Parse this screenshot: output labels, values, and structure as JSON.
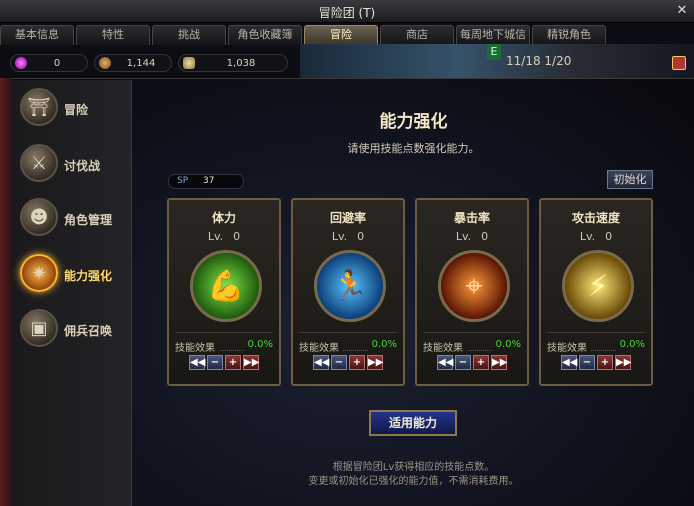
{
  "window": {
    "title": "冒险团 (T)"
  },
  "tabs": [
    {
      "label": "基本信息"
    },
    {
      "label": "特性"
    },
    {
      "label": "挑战"
    },
    {
      "label": "角色收藏簿"
    },
    {
      "label": "冒险"
    },
    {
      "label": "商店"
    },
    {
      "label": "每周地下城信息"
    },
    {
      "label": "精锐角色"
    }
  ],
  "active_tab": "冒险",
  "currency": [
    {
      "icon": "gem-icon",
      "value": "0"
    },
    {
      "icon": "coin-icon",
      "value": "1,144"
    },
    {
      "icon": "token-icon",
      "value": "1,038"
    }
  ],
  "background": {
    "date_text": "11/18 1/20",
    "e_badge": "E"
  },
  "sidebar": {
    "items": [
      {
        "label": "冒险",
        "icon": "adventure-icon",
        "glyph": "⛩"
      },
      {
        "label": "讨伐战",
        "icon": "crossed-swords-icon",
        "glyph": "⚔"
      },
      {
        "label": "角色管理",
        "icon": "character-icon",
        "glyph": "☻"
      },
      {
        "label": "能力强化",
        "icon": "star-burst-icon",
        "glyph": "✷"
      },
      {
        "label": "佣兵召唤",
        "icon": "chest-icon",
        "glyph": "▣"
      }
    ],
    "active": "能力强化"
  },
  "content": {
    "title": "能力强化",
    "subtitle": "请使用技能点数强化能力。",
    "sp_label": "SP",
    "sp_value": "37",
    "reset_label": "初始化",
    "cards": [
      {
        "name": "体力",
        "lv_label": "Lv.",
        "lv_value": "0",
        "icon": "muscle-icon",
        "glyph": "💪",
        "effect_label": "技能效果",
        "effect_value": "0.0%"
      },
      {
        "name": "回避率",
        "lv_label": "Lv.",
        "lv_value": "0",
        "icon": "runner-icon",
        "glyph": "🏃",
        "effect_label": "技能效果",
        "effect_value": "0.0%"
      },
      {
        "name": "暴击率",
        "lv_label": "Lv.",
        "lv_value": "0",
        "icon": "crosshair-icon",
        "glyph": "⌖",
        "effect_label": "技能效果",
        "effect_value": "0.0%"
      },
      {
        "name": "攻击速度",
        "lv_label": "Lv.",
        "lv_value": "0",
        "icon": "blade-icon",
        "glyph": "⚡",
        "effect_label": "技能效果",
        "effect_value": "0.0%"
      }
    ],
    "stepper": {
      "min": "◀◀",
      "minus": "−",
      "plus": "+",
      "max": "▶▶"
    },
    "apply_label": "适用能力",
    "note_line1": "根据冒险团Lv获得相应的技能点数。",
    "note_line2": "变更或初始化已强化的能力值，不需消耗费用。"
  },
  "colors": {
    "accent_gold": "#f7b52b",
    "effect_green": "#4bd441",
    "icon_vitality": "#4fc12a",
    "icon_evasion": "#2a8fe0",
    "icon_crit": "#e0501a",
    "icon_speed": "#e8c12a"
  }
}
